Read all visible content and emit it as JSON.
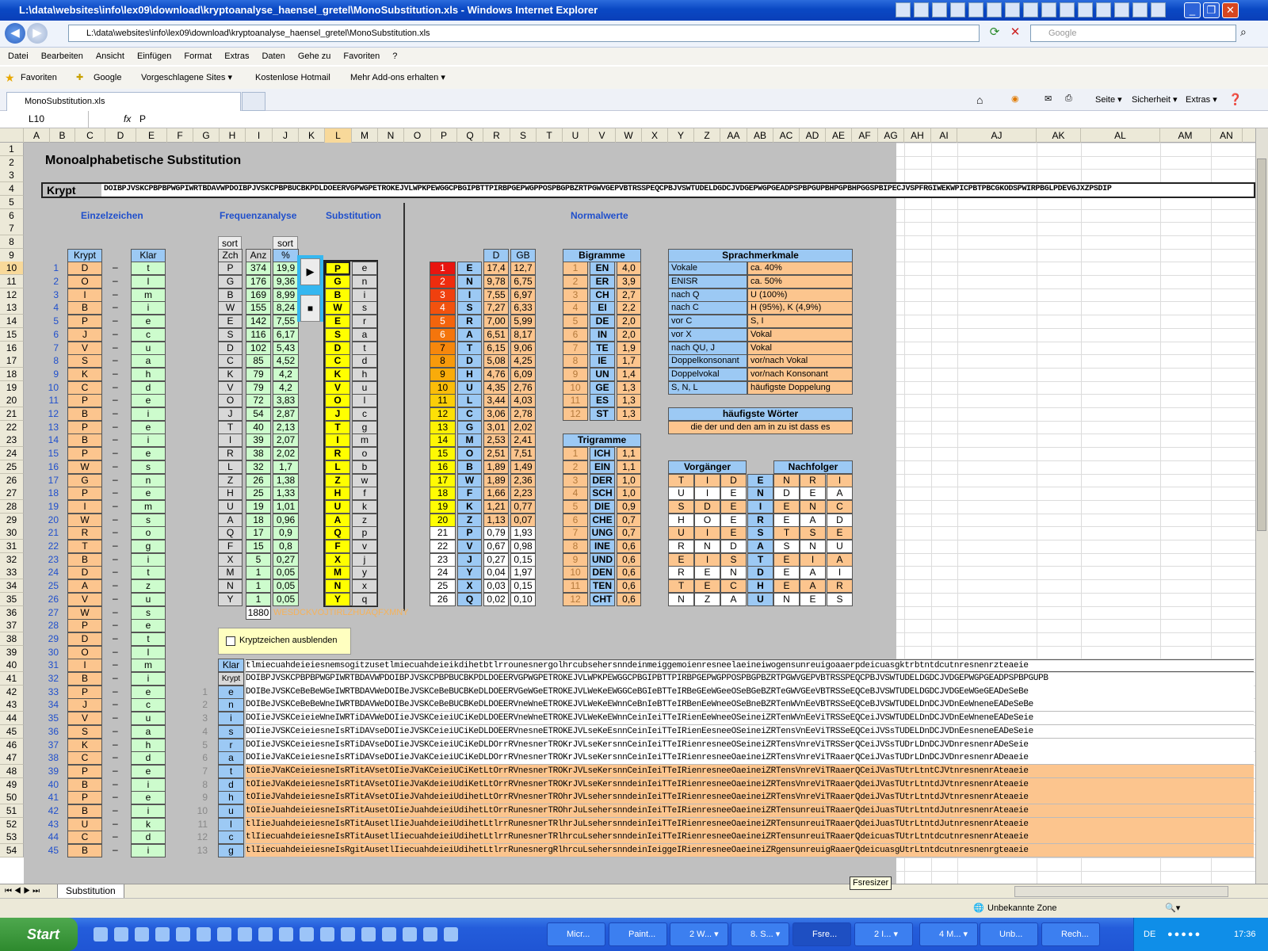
{
  "window": {
    "title": "L:\\data\\websites\\info\\lex09\\download\\kryptoanalyse_haensel_gretel\\MonoSubstitution.xls - Windows Internet Explorer"
  },
  "address": {
    "url": "L:\\data\\websites\\info\\lex09\\download\\kryptoanalyse_haensel_gretel\\MonoSubstitution.xls",
    "search_placeholder": "Google"
  },
  "menu": [
    "Datei",
    "Bearbeiten",
    "Ansicht",
    "Einfügen",
    "Format",
    "Extras",
    "Daten",
    "Gehe zu",
    "Favoriten",
    "?"
  ],
  "favorites": {
    "label": "Favoriten",
    "links": [
      "Google",
      "Vorgeschlagene Sites ▾",
      "Kostenlose Hotmail",
      "Mehr Add-ons erhalten ▾"
    ]
  },
  "tab": {
    "label": "MonoSubstitution.xls"
  },
  "cmdbar": [
    "Seite ▾",
    "Sicherheit ▾",
    "Extras ▾"
  ],
  "formula": {
    "namebox": "L10",
    "fx": "fx",
    "value": "P"
  },
  "sheet": {
    "title": "Monoalphabetische Substitution",
    "krypt_label": "Krypt",
    "krypt_text": "DOIBPJVSKCPBPBPWGPIWRTBDAVWPDOIBPJVSKCPBPBUCBKPDLDOEERVGPWGPETROKEJVLWPKPEWGGCPBGIPBTTPIRBPGEPWGPPOSPBGPBZRTPGWVGEPVBTRSSPEQCPBJVSWTUDELDGDCJVDGEPWGPGEADPSPBPGUPBHPGPBHPGGSPBIPECJVSPFRGIWEKWPICPBTPBCGKODSPWIRPBGLPDEVGJXZPSDIP",
    "headers": {
      "einzel": "Einzelzeichen",
      "freq": "Frequenzanalyse",
      "subst": "Substitution",
      "normal": "Normalwerte"
    },
    "sort": "sort",
    "einzel_cols": [
      "Krypt",
      "Klar"
    ],
    "dash": "–",
    "einzel": [
      [
        "D",
        "t"
      ],
      [
        "O",
        "l"
      ],
      [
        "I",
        "m"
      ],
      [
        "B",
        "i"
      ],
      [
        "P",
        "e"
      ],
      [
        "J",
        "c"
      ],
      [
        "V",
        "u"
      ],
      [
        "S",
        "a"
      ],
      [
        "K",
        "h"
      ],
      [
        "C",
        "d"
      ],
      [
        "P",
        "e"
      ],
      [
        "B",
        "i"
      ],
      [
        "P",
        "e"
      ],
      [
        "B",
        "i"
      ],
      [
        "P",
        "e"
      ],
      [
        "W",
        "s"
      ],
      [
        "G",
        "n"
      ],
      [
        "P",
        "e"
      ],
      [
        "I",
        "m"
      ],
      [
        "W",
        "s"
      ],
      [
        "R",
        "o"
      ],
      [
        "T",
        "g"
      ],
      [
        "B",
        "i"
      ],
      [
        "D",
        "t"
      ],
      [
        "A",
        "z"
      ],
      [
        "V",
        "u"
      ],
      [
        "W",
        "s"
      ],
      [
        "P",
        "e"
      ],
      [
        "D",
        "t"
      ],
      [
        "O",
        "l"
      ],
      [
        "I",
        "m"
      ],
      [
        "B",
        "i"
      ],
      [
        "P",
        "e"
      ],
      [
        "J",
        "c"
      ],
      [
        "V",
        "u"
      ],
      [
        "S",
        "a"
      ],
      [
        "K",
        "h"
      ],
      [
        "C",
        "d"
      ],
      [
        "P",
        "e"
      ],
      [
        "B",
        "i"
      ],
      [
        "P",
        "e"
      ],
      [
        "B",
        "i"
      ],
      [
        "U",
        "k"
      ],
      [
        "C",
        "d"
      ],
      [
        "B",
        "i"
      ]
    ],
    "freq_cols": [
      "Zch",
      "Anz",
      "%"
    ],
    "freq": [
      [
        "P",
        "374",
        "19,9"
      ],
      [
        "G",
        "176",
        "9,36"
      ],
      [
        "B",
        "169",
        "8,99"
      ],
      [
        "W",
        "155",
        "8,24"
      ],
      [
        "E",
        "142",
        "7,55"
      ],
      [
        "S",
        "116",
        "6,17"
      ],
      [
        "D",
        "102",
        "5,43"
      ],
      [
        "C",
        "85",
        "4,52"
      ],
      [
        "K",
        "79",
        "4,2"
      ],
      [
        "V",
        "79",
        "4,2"
      ],
      [
        "O",
        "72",
        "3,83"
      ],
      [
        "J",
        "54",
        "2,87"
      ],
      [
        "T",
        "40",
        "2,13"
      ],
      [
        "I",
        "39",
        "2,07"
      ],
      [
        "R",
        "38",
        "2,02"
      ],
      [
        "L",
        "32",
        "1,7"
      ],
      [
        "Z",
        "26",
        "1,38"
      ],
      [
        "H",
        "25",
        "1,33"
      ],
      [
        "U",
        "19",
        "1,01"
      ],
      [
        "A",
        "18",
        "0,96"
      ],
      [
        "Q",
        "17",
        "0,9"
      ],
      [
        "F",
        "15",
        "0,8"
      ],
      [
        "X",
        "5",
        "0,27"
      ],
      [
        "M",
        "1",
        "0,05"
      ],
      [
        "N",
        "1",
        "0,05"
      ],
      [
        "Y",
        "1",
        "0,05"
      ]
    ],
    "freq_total": "1880",
    "freq_rest": "WESDCKVOJTIRLZHUAQFXMNY",
    "play_btn": "▶",
    "stop_btn": "■",
    "subst": [
      [
        "P",
        "e"
      ],
      [
        "G",
        "n"
      ],
      [
        "B",
        "i"
      ],
      [
        "W",
        "s"
      ],
      [
        "E",
        "r"
      ],
      [
        "S",
        "a"
      ],
      [
        "D",
        "t"
      ],
      [
        "C",
        "d"
      ],
      [
        "K",
        "h"
      ],
      [
        "V",
        "u"
      ],
      [
        "O",
        "l"
      ],
      [
        "J",
        "c"
      ],
      [
        "T",
        "g"
      ],
      [
        "I",
        "m"
      ],
      [
        "R",
        "o"
      ],
      [
        "L",
        "b"
      ],
      [
        "Z",
        "w"
      ],
      [
        "H",
        "f"
      ],
      [
        "U",
        "k"
      ],
      [
        "A",
        "z"
      ],
      [
        "Q",
        "p"
      ],
      [
        "F",
        "v"
      ],
      [
        "X",
        "j"
      ],
      [
        "M",
        "y"
      ],
      [
        "N",
        "x"
      ],
      [
        "Y",
        "q"
      ]
    ],
    "normal_cols": [
      "D",
      "GB"
    ],
    "normal": [
      [
        "E",
        "17,4",
        "12,7"
      ],
      [
        "N",
        "9,78",
        "6,75"
      ],
      [
        "I",
        "7,55",
        "6,97"
      ],
      [
        "S",
        "7,27",
        "6,33"
      ],
      [
        "R",
        "7,00",
        "5,99"
      ],
      [
        "A",
        "6,51",
        "8,17"
      ],
      [
        "T",
        "6,15",
        "9,06"
      ],
      [
        "D",
        "5,08",
        "4,25"
      ],
      [
        "H",
        "4,76",
        "6,09"
      ],
      [
        "U",
        "4,35",
        "2,76"
      ],
      [
        "L",
        "3,44",
        "4,03"
      ],
      [
        "C",
        "3,06",
        "2,78"
      ],
      [
        "G",
        "3,01",
        "2,02"
      ],
      [
        "M",
        "2,53",
        "2,41"
      ],
      [
        "O",
        "2,51",
        "7,51"
      ],
      [
        "B",
        "1,89",
        "1,49"
      ],
      [
        "W",
        "1,89",
        "2,36"
      ],
      [
        "F",
        "1,66",
        "2,23"
      ],
      [
        "K",
        "1,21",
        "0,77"
      ],
      [
        "Z",
        "1,13",
        "0,07"
      ],
      [
        "P",
        "0,79",
        "1,93"
      ],
      [
        "V",
        "0,67",
        "0,98"
      ],
      [
        "J",
        "0,27",
        "0,15"
      ],
      [
        "Y",
        "0,04",
        "1,97"
      ],
      [
        "X",
        "0,03",
        "0,15"
      ],
      [
        "Q",
        "0,02",
        "0,10"
      ]
    ],
    "bigramme_title": "Bigramme",
    "bigramme": [
      [
        "EN",
        "4,0"
      ],
      [
        "ER",
        "3,9"
      ],
      [
        "CH",
        "2,7"
      ],
      [
        "EI",
        "2,2"
      ],
      [
        "DE",
        "2,0"
      ],
      [
        "IN",
        "2,0"
      ],
      [
        "TE",
        "1,9"
      ],
      [
        "IE",
        "1,7"
      ],
      [
        "UN",
        "1,4"
      ],
      [
        "GE",
        "1,3"
      ],
      [
        "ES",
        "1,3"
      ],
      [
        "ST",
        "1,3"
      ]
    ],
    "trigramme_title": "Trigramme",
    "trigramme": [
      [
        "ICH",
        "1,1"
      ],
      [
        "EIN",
        "1,1"
      ],
      [
        "DER",
        "1,0"
      ],
      [
        "SCH",
        "1,0"
      ],
      [
        "DIE",
        "0,9"
      ],
      [
        "CHE",
        "0,7"
      ],
      [
        "UNG",
        "0,7"
      ],
      [
        "INE",
        "0,6"
      ],
      [
        "UND",
        "0,6"
      ],
      [
        "DEN",
        "0,6"
      ],
      [
        "TEN",
        "0,6"
      ],
      [
        "CHT",
        "0,6"
      ]
    ],
    "sprach_title": "Sprachmerkmale",
    "sprach": [
      [
        "Vokale",
        "ca. 40%"
      ],
      [
        "ENISR",
        "ca. 50%"
      ],
      [
        "nach Q",
        "U (100%)"
      ],
      [
        "nach C",
        "H (95%), K (4,9%)"
      ],
      [
        "vor C",
        "S, I"
      ],
      [
        "vor X",
        "Vokal"
      ],
      [
        "nach QU, J",
        "Vokal"
      ],
      [
        "Doppelkonsonant",
        "vor/nach Vokal"
      ],
      [
        "Doppelvokal",
        "vor/nach Konsonant"
      ],
      [
        "S, N, L",
        "häufigste Doppelung"
      ]
    ],
    "woerter_title": "häufigste Wörter",
    "woerter": "die der und den am in zu ist dass es",
    "vorg_title": "Vorgänger",
    "nachf_title": "Nachfolger",
    "vn": [
      [
        "T",
        "I",
        "D",
        "E",
        "N",
        "R",
        "I"
      ],
      [
        "U",
        "I",
        "E",
        "N",
        "D",
        "E",
        "A"
      ],
      [
        "S",
        "D",
        "E",
        "I",
        "E",
        "N",
        "C"
      ],
      [
        "H",
        "O",
        "E",
        "R",
        "E",
        "A",
        "D"
      ],
      [
        "U",
        "I",
        "E",
        "S",
        "T",
        "S",
        "E"
      ],
      [
        "R",
        "N",
        "D",
        "A",
        "S",
        "N",
        "U"
      ],
      [
        "E",
        "I",
        "S",
        "T",
        "E",
        "I",
        "A"
      ],
      [
        "R",
        "E",
        "N",
        "D",
        "E",
        "A",
        "I"
      ],
      [
        "T",
        "E",
        "C",
        "H",
        "E",
        "A",
        "R"
      ],
      [
        "N",
        "Z",
        "A",
        "U",
        "N",
        "E",
        "S"
      ]
    ],
    "checkbox_label": "Kryptzeichen ausblenden",
    "klar_label": "Klar",
    "krypt2_label": "Krypt",
    "klar_text": "tlmiecuahdeieiesnemsogitzusetlmiecuahdeieikdihetbtlrrounesnergolhrcubsehersnndeinmeiggemoienresneelaeineiwogensunreuigoaaerpdeicuasgktrbtntdcutnresnenrzteaeie",
    "krypt_text2": "DOIBPJVSKCPBPBPWGPIWRTBDAVWPDOIBPJVSKCPBPBUCBKPDLDOEERVGPWGPETROKEJVLWPKPEWGGCPBGIPBTTPIRBPGEPWGPPOSPBGPBZRTPGWVGEPVBTRSSPEQCPBJVSWTUDELDGDCJVDGEPWGPGEADPSPBPGUPB",
    "steps": [
      [
        "e",
        "DOIBeJVSKCeBeBeWGeIWRTBDAVWeDOIBeJVSKCeBeBUCBKeDLDOEERVGeWGeETROKEJVLWeKeEWGGCeBGIeBTTeIRBeGEeWGeeOSeBGeBZRTeGWVGEeVBTRSSeEQCeBJVSWTUDELDGDCJVDGEeWGeGEADeSeBe"
      ],
      [
        "n",
        "DOIBeJVSKCeBeBeWneIWRTBDAVWeDOIBeJVSKCeBeBUCBKeDLDOEERVneWneETROKEJVLWeKeEWnnCeBnIeBTTeIRBenEeWneeOSeBneBZRTenWVnEeVBTRSSeEQCeBJVSWTUDELDnDCJVDnEeWneneEADeSeBe"
      ],
      [
        "i",
        "DOIieJVSKCeieieWneIWRTiDAVWeDOIieJVSKCeieiUCiKeDLDOEERVneWneETROKEJVLWeKeEWnnCeinIeiTTeIRienEeWneeOSeineiZRTenWVnEeViTRSSeEQCeiJVSWTUDELDnDCJVDnEeWneneEADeSeie"
      ],
      [
        "s",
        "DOIieJVSKCeieiesneIsRTiDAVseDOIieJVSKCeieiUCiKeDLDOEERVnesneETROKEJVLseKeEsnnCeinIeiTTeIRienEesneeOSeineiZRTensVnEeViTRSSeEQCeiJVSsTUDELDnDCJVDnEesneneEADeSeie"
      ],
      [
        "r",
        "DOIieJVSKCeieiesneIsRTiDAVseDOIieJVSKCeieiUCiKeDLDOrrRVnesnerTROKrJVLseKersnnCeinIeiTTeIRienresneeOSeineiZRTensVnreViTRSSerQCeiJVSsTUDrLDnDCJVDnresnenrADeSeie"
      ],
      [
        "a",
        "DOIieJVaKCeieiesneIsRTiDAVseDOIieJVaKCeieiUCiKeDLDOrrRVnesnerTROKrJVLseKersnnCeinIeiTTeIRienresneeOaeineiZRTensVnreViTRaaerQCeiJVasTUDrLDnDCJVDnresnenrADeaeie"
      ],
      [
        "t",
        "tOIieJVaKCeieiesneIsRTitAVsetOIieJVaKCeieiUCiKetLtOrrRVnesnerTROKrJVLseKersnnCeinIeiTTeIRienresneeOaeineiZRTensVnreViTRaaerQCeiJVasTUtrLtntCJVtnresnenrAteaeie"
      ],
      [
        "d",
        "tOIieJVaKdeieiesneIsRTitAVsetOIieJVaKdeieiUdiKetLtOrrRVnesnerTROKrJVLseKersnndeinIeiTTeIRienresneeOaeineiZRTensVnreViTRaaerQdeiJVasTUtrLtntdJVtnresnenrAteaeie"
      ],
      [
        "h",
        "tOIieJVahdeieiesneIsRTitAVsetOIieJVahdeieiUdihetLtOrrRVnesnerTROhrJVLsehersnndeinIeiTTeIRienresneeOaeineiZRTensVnreViTRaaerQdeiJVasTUtrLtntdJVtnresnenrAteaeie"
      ],
      [
        "u",
        "tOIieJuahdeieiesneIsRTitAusetOIieJuahdeieiUdihetLtOrrRunesnerTROhrJuLsehersnndeinIeiTTeIRienresneeOaeineiZRTensunreuiTRaaerQdeiJuasTUtrLtntdJutnresnenrAteaeie"
      ],
      [
        "l",
        "tlIieJuahdeieiesneIsRTitAusetlIieJuahdeieiUdihetLtlrrRunesnerTRlhrJuLsehersnndeinIeiTTeIRienresneeOaeineiZRTensunreuiTRaaerQdeiJuasTUtrLtntdJutnresnenrAteaeie"
      ],
      [
        "c",
        "tlIiecuahdeieiesneIsRTitAusetlIiecuahdeieiUdihetLtlrrRunesnerTRlhrcuLsehersnndeinIeiTTeIRienresneeOaeineiZRTensunreuiTRaaerQdeicuasTUtrLtntdcutnresnenrAteaeie"
      ],
      [
        "g",
        "tlIiecuahdeieiesneIsRgitAusetlIiecuahdeieiUdihetLtlrrRunesnergRlhrcuLsehersnndeinIeiggeIRienresneeOaeineiZRgensunreuigRaaerQdeicuasgUtrLtntdcutnresnenrgteaeie"
      ]
    ]
  },
  "sheettab": "Substitution",
  "status": {
    "zone": "Unbekannte Zone",
    "tooltip": "Fsresizer"
  },
  "taskbar": {
    "start": "Start",
    "buttons": [
      "Micr...",
      "Paint...",
      "2 W... ▾",
      "8. S... ▾",
      "Fsre...",
      "2 I... ▾",
      "4 M... ▾",
      "Unb...",
      "Rech..."
    ],
    "lang": "DE",
    "clock": "17:36"
  }
}
